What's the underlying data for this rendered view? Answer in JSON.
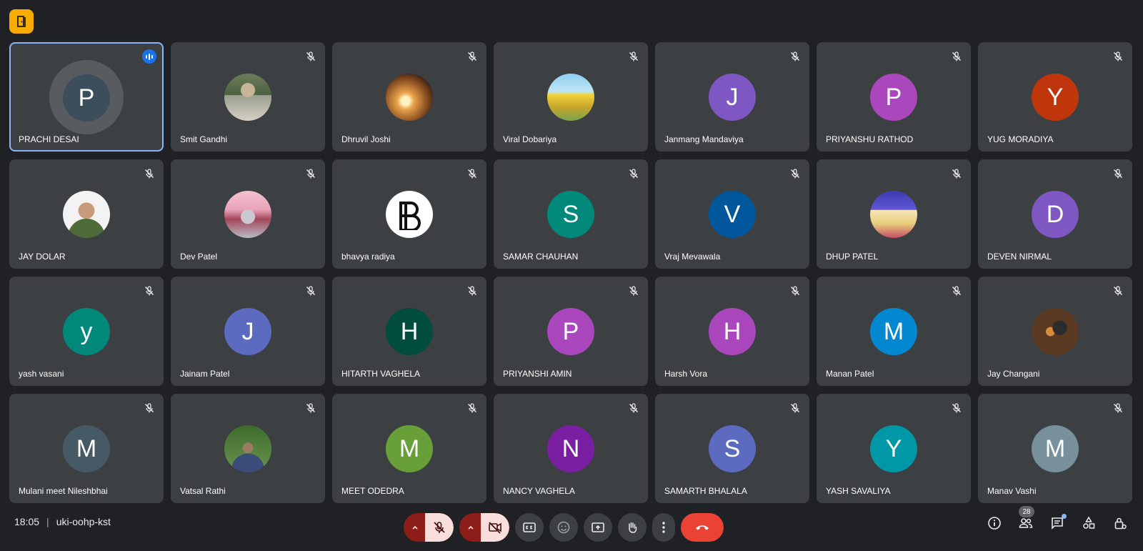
{
  "app": {
    "logo_icon": "door-icon",
    "accent": "#f9ab00"
  },
  "participants": [
    {
      "name": "PRACHI DESAI",
      "initial": "P",
      "color": "#3c4e5a",
      "photo": "",
      "speaking": true,
      "muted": false
    },
    {
      "name": "Smit Gandhi",
      "initial": "",
      "color": "",
      "photo": "photo-smit",
      "speaking": false,
      "muted": true
    },
    {
      "name": "Dhruvil Joshi",
      "initial": "",
      "color": "",
      "photo": "photo-dhruvil",
      "speaking": false,
      "muted": true
    },
    {
      "name": "Viral Dobariya",
      "initial": "",
      "color": "",
      "photo": "photo-viral",
      "speaking": false,
      "muted": true
    },
    {
      "name": "Janmang Mandaviya",
      "initial": "J",
      "color": "#7e57c2",
      "photo": "",
      "speaking": false,
      "muted": true
    },
    {
      "name": "PRIYANSHU RATHOD",
      "initial": "P",
      "color": "#ab47bc",
      "photo": "",
      "speaking": false,
      "muted": true
    },
    {
      "name": "YUG MORADIYA",
      "initial": "Y",
      "color": "#bf360c",
      "photo": "",
      "speaking": false,
      "muted": true
    },
    {
      "name": "JAY DOLAR",
      "initial": "",
      "color": "",
      "photo": "photo-jay",
      "speaking": false,
      "muted": true
    },
    {
      "name": "Dev Patel",
      "initial": "",
      "color": "",
      "photo": "photo-dev",
      "speaking": false,
      "muted": true
    },
    {
      "name": "bhavya radiya",
      "initial": "",
      "color": "",
      "photo": "photo-bhavya",
      "speaking": false,
      "muted": true
    },
    {
      "name": "SAMAR CHAUHAN",
      "initial": "S",
      "color": "#00897b",
      "photo": "",
      "speaking": false,
      "muted": true
    },
    {
      "name": "Vraj Mevawala",
      "initial": "V",
      "color": "#01579b",
      "photo": "",
      "speaking": false,
      "muted": true
    },
    {
      "name": "DHUP PATEL",
      "initial": "",
      "color": "",
      "photo": "photo-dhup",
      "speaking": false,
      "muted": true
    },
    {
      "name": "DEVEN NIRMAL",
      "initial": "D",
      "color": "#7e57c2",
      "photo": "",
      "speaking": false,
      "muted": true
    },
    {
      "name": "yash vasani",
      "initial": "y",
      "color": "#00897b",
      "photo": "",
      "speaking": false,
      "muted": true
    },
    {
      "name": "Jainam Patel",
      "initial": "J",
      "color": "#5c6bc0",
      "photo": "",
      "speaking": false,
      "muted": true
    },
    {
      "name": "HITARTH VAGHELA",
      "initial": "H",
      "color": "#004d40",
      "photo": "",
      "speaking": false,
      "muted": true
    },
    {
      "name": "PRIYANSHI AMIN",
      "initial": "P",
      "color": "#ab47bc",
      "photo": "",
      "speaking": false,
      "muted": true
    },
    {
      "name": "Harsh Vora",
      "initial": "H",
      "color": "#ab47bc",
      "photo": "",
      "speaking": false,
      "muted": true
    },
    {
      "name": "Manan Patel",
      "initial": "M",
      "color": "#0288d1",
      "photo": "",
      "speaking": false,
      "muted": true
    },
    {
      "name": "Jay Changani",
      "initial": "",
      "color": "",
      "photo": "photo-jayc",
      "speaking": false,
      "muted": true
    },
    {
      "name": "Mulani meet Nileshbhai",
      "initial": "M",
      "color": "#455a64",
      "photo": "",
      "speaking": false,
      "muted": true
    },
    {
      "name": "Vatsal Rathi",
      "initial": "",
      "color": "",
      "photo": "photo-vatsal",
      "speaking": false,
      "muted": true
    },
    {
      "name": "MEET ODEDRA",
      "initial": "M",
      "color": "#689f38",
      "photo": "",
      "speaking": false,
      "muted": true
    },
    {
      "name": "NANCY VAGHELA",
      "initial": "N",
      "color": "#7b1fa2",
      "photo": "",
      "speaking": false,
      "muted": true
    },
    {
      "name": "SAMARTH BHALALA",
      "initial": "S",
      "color": "#5c6bc0",
      "photo": "",
      "speaking": false,
      "muted": true
    },
    {
      "name": "YASH SAVALIYA",
      "initial": "Y",
      "color": "#0097a7",
      "photo": "",
      "speaking": false,
      "muted": true
    },
    {
      "name": "Manav Vashi",
      "initial": "M",
      "color": "#78909c",
      "photo": "",
      "speaking": false,
      "muted": true
    }
  ],
  "footer": {
    "time": "18:05",
    "separator": "|",
    "meeting_code": "uki-oohp-kst",
    "participants_count": "28"
  },
  "controls": {
    "mic_icon": "mic-off-icon",
    "camera_icon": "videocam-off-icon",
    "captions_icon": "closed-captions-icon",
    "emoji_icon": "emoji-icon",
    "present_icon": "present-screen-icon",
    "hand_icon": "raise-hand-icon",
    "more_icon": "more-options-icon",
    "end_call_icon": "end-call-icon",
    "end_call_color": "#ea4335"
  },
  "right_tools": [
    "info-icon",
    "people-icon",
    "chat-icon",
    "activities-icon",
    "host-controls-icon"
  ]
}
